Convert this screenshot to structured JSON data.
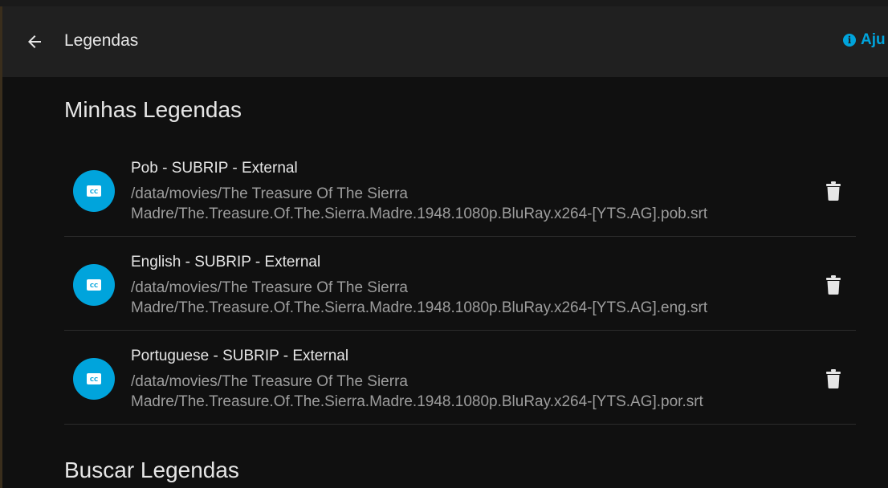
{
  "header": {
    "title": "Legendas",
    "back_icon": "arrow-left-icon",
    "help_label": "Aju",
    "help_icon": "info-icon"
  },
  "my_subtitles": {
    "title": "Minhas Legendas",
    "items": [
      {
        "title": "Pob - SUBRIP - External",
        "path_line1": "/data/movies/The Treasure Of The Sierra",
        "path_line2": "Madre/The.Treasure.Of.The.Sierra.Madre.1948.1080p.BluRay.x264-[YTS.AG].pob.srt",
        "icon": "closed-captions-icon",
        "delete_icon": "trash-icon"
      },
      {
        "title": "English - SUBRIP - External",
        "path_line1": "/data/movies/The Treasure Of The Sierra",
        "path_line2": "Madre/The.Treasure.Of.The.Sierra.Madre.1948.1080p.BluRay.x264-[YTS.AG].eng.srt",
        "icon": "closed-captions-icon",
        "delete_icon": "trash-icon"
      },
      {
        "title": "Portuguese - SUBRIP - External",
        "path_line1": "/data/movies/The Treasure Of The Sierra",
        "path_line2": "Madre/The.Treasure.Of.The.Sierra.Madre.1948.1080p.BluRay.x264-[YTS.AG].por.srt",
        "icon": "closed-captions-icon",
        "delete_icon": "trash-icon"
      }
    ]
  },
  "search_subtitles": {
    "title": "Buscar Legendas"
  },
  "colors": {
    "accent": "#00a4dc",
    "header_bg": "#202020",
    "dialog_bg": "#101010",
    "text_primary": "#e6e6e6",
    "text_secondary": "#9d9d9d"
  }
}
